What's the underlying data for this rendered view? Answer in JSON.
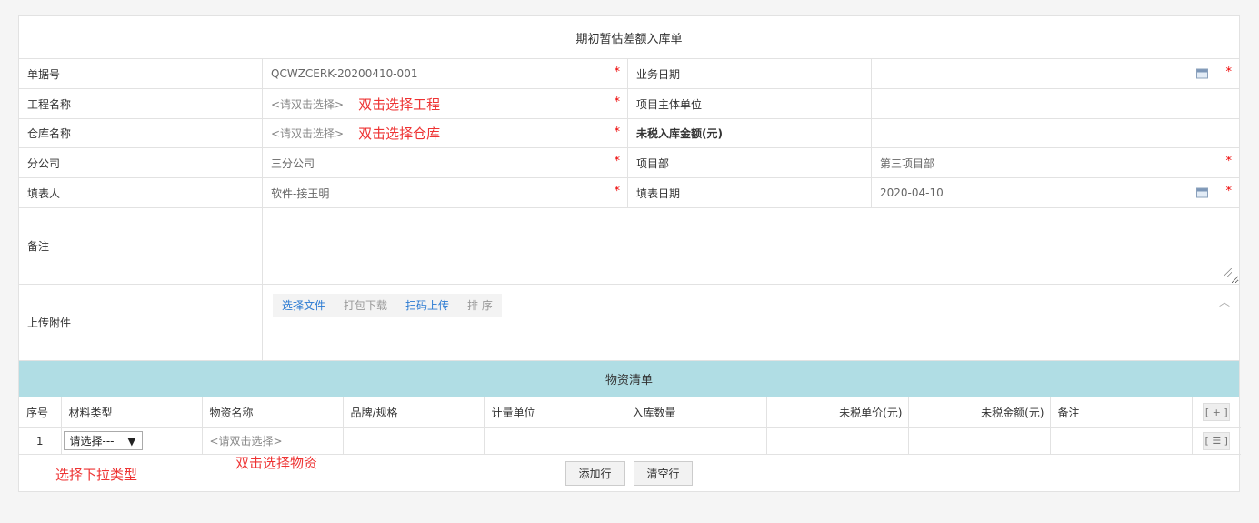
{
  "form": {
    "title": "期初暂估差额入库单",
    "rows": [
      {
        "l1": "单据号",
        "v1": "QCWZCERK-20200410-001",
        "l2": "业务日期",
        "v2": ""
      },
      {
        "l1": "工程名称",
        "v1": "<请双击选择>",
        "h1": "双击选择工程",
        "l2": "项目主体单位",
        "v2": ""
      },
      {
        "l1": "仓库名称",
        "v1": "<请双击选择>",
        "h1": "双击选择仓库",
        "l2": "未税入库金额(元)",
        "v2": ""
      },
      {
        "l1": "分公司",
        "v1": "三分公司",
        "l2": "项目部",
        "v2": "第三项目部"
      },
      {
        "l1": "填表人",
        "v1": "软件-接玉明",
        "l2": "填表日期",
        "v2": "2020-04-10"
      }
    ],
    "required_mark": "*",
    "remark_label": "备注",
    "remark_value": "",
    "attachment_label": "上传附件",
    "upload_buttons": [
      "选择文件",
      "打包下载",
      "扫码上传",
      "排 序"
    ]
  },
  "materials": {
    "title": "物资清单",
    "columns": [
      "序号",
      "材料类型",
      "物资名称",
      "品牌/规格",
      "计量单位",
      "入库数量",
      "未税单价(元)",
      "未税金额(元)",
      "备注"
    ],
    "add_col_button": "[ + ]",
    "rows": [
      {
        "index": "1",
        "type": "请选择---",
        "name": "<请双击选择>",
        "row_button": "[ ☰ ]"
      }
    ],
    "add_row_button": "添加行",
    "clear_rows_button": "清空行",
    "hint_type": "选择下拉类型",
    "hint_name": "双击选择物资"
  }
}
